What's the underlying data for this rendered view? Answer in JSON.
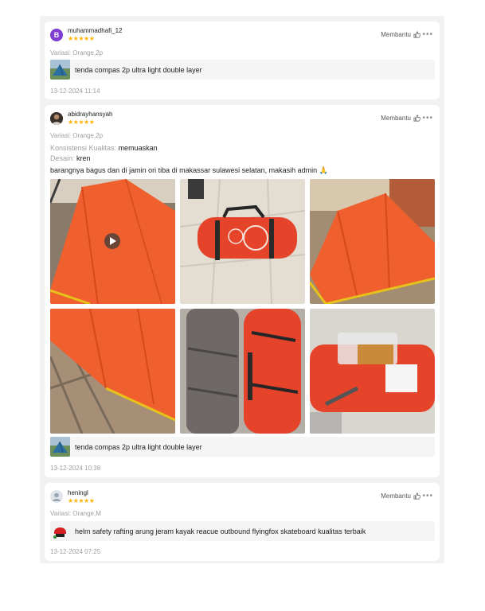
{
  "reviews": [
    {
      "username": "muhammadhafi_12",
      "avatar_letter": "B",
      "rating": 5,
      "stars": "★★★★★",
      "helpful_label": "Membantu",
      "variant": "Variasi: Orange,2p",
      "product_name": "tenda compas 2p ultra light double layer",
      "date": "13-12-2024 11:14"
    },
    {
      "username": "abidrayhansyah",
      "rating": 5,
      "stars": "★★★★★",
      "helpful_label": "Membantu",
      "variant": "Variasi: Orange,2p",
      "quality_key": "Konsistensi Kualitas:",
      "quality_value": "memuaskan",
      "design_key": "Desain:",
      "design_value": "kren",
      "text": "barangnya bagus dan di jamin ori tiba di makassar sulawesi selatan, makasih admin 🙏",
      "media_count": 6,
      "media_types": [
        "video",
        "image",
        "image",
        "image",
        "image",
        "image"
      ],
      "product_name": "tenda compas 2p ultra light double layer",
      "date": "13-12-2024 10:38"
    },
    {
      "username": "heningl",
      "rating": 5,
      "stars": "★★★★★",
      "helpful_label": "Membantu",
      "variant": "Variasi: Orange,M",
      "product_name": "helm safety rafting arung jeram kayak reacue outbound flyingfox skateboard kualitas terbaik",
      "date": "13-12-2024 07:25"
    }
  ],
  "icons": {
    "helpful": "thumbs-up-icon",
    "more": "more-options-icon",
    "play": "play-icon"
  },
  "colors": {
    "star": "#ffb300",
    "tent_orange": "#f0602e",
    "muted_text": "#9e9e9e"
  }
}
